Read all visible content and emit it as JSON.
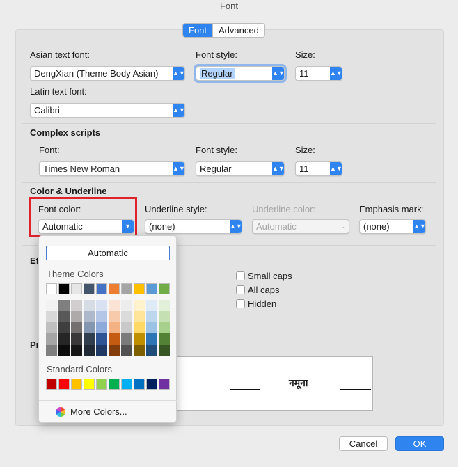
{
  "window": {
    "title": "Font"
  },
  "tabs": [
    {
      "label": "Font",
      "active": true
    },
    {
      "label": "Advanced",
      "active": false
    }
  ],
  "asian": {
    "label": "Asian text font:",
    "value": "DengXian (Theme Body Asian)",
    "style_label": "Font style:",
    "style_value": "Regular",
    "size_label": "Size:",
    "size_value": "11"
  },
  "latin": {
    "label": "Latin text font:",
    "value": "Calibri"
  },
  "complex": {
    "heading": "Complex scripts",
    "font_label": "Font:",
    "font_value": "Times New Roman",
    "style_label": "Font style:",
    "style_value": "Regular",
    "size_label": "Size:",
    "size_value": "11"
  },
  "color_underline": {
    "heading": "Color & Underline",
    "font_color_label": "Font color:",
    "font_color_value": "Automatic",
    "underline_style_label": "Underline style:",
    "underline_style_value": "(none)",
    "underline_color_label": "Underline color:",
    "underline_color_value": "Automatic",
    "emphasis_label": "Emphasis mark:",
    "emphasis_value": "(none)"
  },
  "effects": {
    "heading_fragment": "Ef",
    "options": [
      "Small caps",
      "All caps",
      "Hidden"
    ]
  },
  "preview": {
    "heading_fragment": "Pr",
    "text": "नमूना"
  },
  "buttons": {
    "cancel": "Cancel",
    "ok": "OK"
  },
  "color_menu": {
    "automatic": "Automatic",
    "theme_label": "Theme Colors",
    "standard_label": "Standard Colors",
    "more_colors": "More Colors...",
    "theme_top": [
      "#ffffff",
      "#000000",
      "#e7e6e6",
      "#44546a",
      "#4472c4",
      "#ed7d31",
      "#a5a5a5",
      "#ffc000",
      "#5b9bd5",
      "#70ad47"
    ],
    "theme_shades": [
      [
        "#f2f2f2",
        "#7f7f7f",
        "#d0cece",
        "#d6dce4",
        "#d9e2f3",
        "#fbe4d5",
        "#ededed",
        "#fff2cc",
        "#deebf6",
        "#e2efd9"
      ],
      [
        "#d8d8d8",
        "#595959",
        "#aeaaaa",
        "#adb9ca",
        "#b4c6e7",
        "#f7caac",
        "#dbdbdb",
        "#ffe599",
        "#bdd7ee",
        "#c5e0b3"
      ],
      [
        "#bfbfbf",
        "#3f3f3f",
        "#757070",
        "#8496b0",
        "#8eaadb",
        "#f4b183",
        "#c9c9c9",
        "#ffd965",
        "#9cc3e5",
        "#a8d08d"
      ],
      [
        "#a5a5a5",
        "#262626",
        "#3a3838",
        "#323f4f",
        "#2f5496",
        "#c55a11",
        "#7b7b7b",
        "#bf8f00",
        "#2e75b5",
        "#538135"
      ],
      [
        "#7f7f7f",
        "#0c0c0c",
        "#171616",
        "#222a35",
        "#1f3864",
        "#833c0b",
        "#525252",
        "#7f6000",
        "#1e4e79",
        "#375623"
      ]
    ],
    "standard": [
      "#c00000",
      "#ff0000",
      "#ffc000",
      "#ffff00",
      "#92d050",
      "#00b050",
      "#00b0f0",
      "#0070c0",
      "#002060",
      "#7030a0"
    ]
  }
}
